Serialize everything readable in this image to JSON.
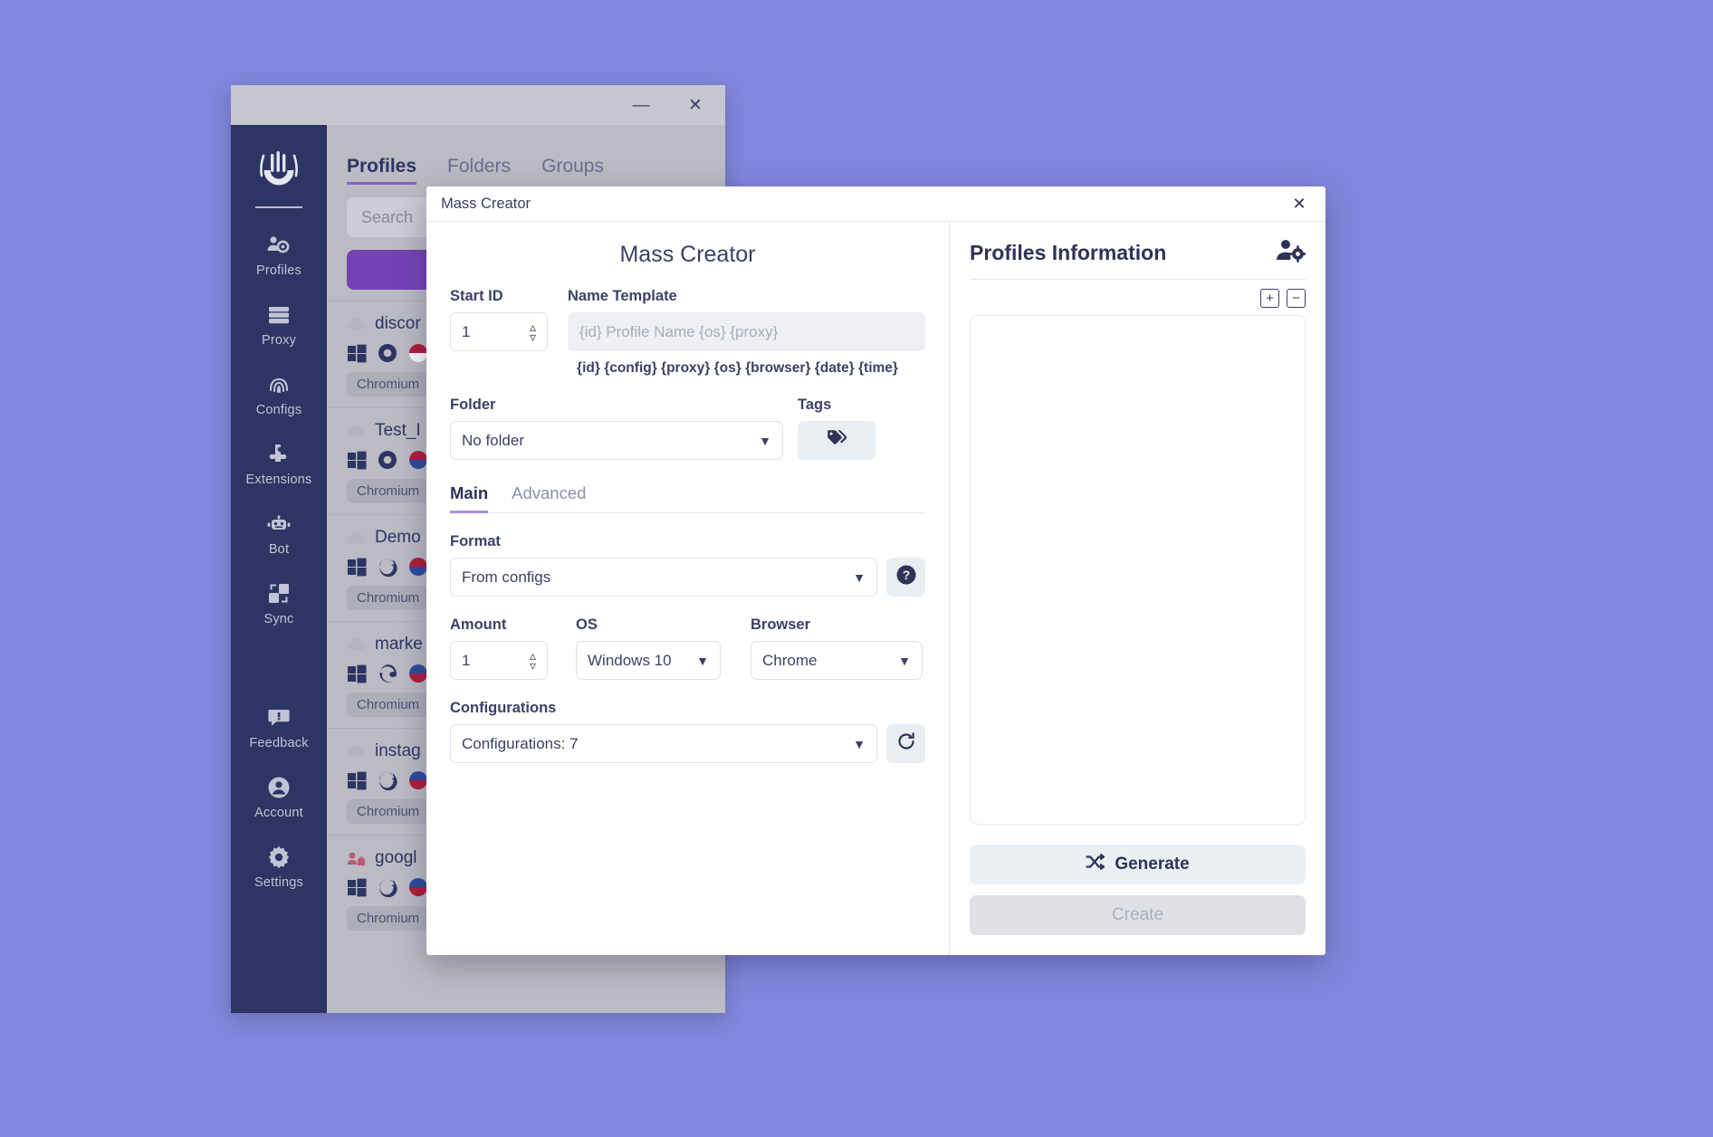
{
  "background_window": {
    "titlebar": {
      "minimize_label": "—",
      "close_label": "✕"
    },
    "sidebar": {
      "logo_name": "undetectable-logo",
      "items": [
        {
          "label": "Profiles",
          "icon": "profiles-icon"
        },
        {
          "label": "Proxy",
          "icon": "proxy-icon"
        },
        {
          "label": "Configs",
          "icon": "configs-icon"
        },
        {
          "label": "Extensions",
          "icon": "extensions-icon"
        },
        {
          "label": "Bot",
          "icon": "bot-icon"
        },
        {
          "label": "Sync",
          "icon": "sync-icon"
        },
        {
          "label": "Feedback",
          "icon": "feedback-icon"
        },
        {
          "label": "Account",
          "icon": "account-icon"
        },
        {
          "label": "Settings",
          "icon": "settings-icon"
        }
      ]
    },
    "tabs": [
      {
        "label": "Profiles",
        "active": true
      },
      {
        "label": "Folders",
        "active": false
      },
      {
        "label": "Groups",
        "active": false
      }
    ],
    "search_placeholder": "Search",
    "profile_rows": [
      {
        "name": "discor",
        "badge": "Chromium",
        "browser_icon": "chrome-icon",
        "shared": false
      },
      {
        "name": "Test_I",
        "badge": "Chromium",
        "browser_icon": "chrome-icon",
        "shared": false
      },
      {
        "name": "Demo",
        "badge": "Chromium",
        "browser_icon": "firefox-icon",
        "shared": false
      },
      {
        "name": "marke",
        "badge": "Chromium",
        "browser_icon": "edge-icon",
        "shared": false
      },
      {
        "name": "instag",
        "badge": "Chromium",
        "browser_icon": "firefox-icon",
        "shared": false
      },
      {
        "name": "googl",
        "badge": "Chromium",
        "browser_icon": "firefox-icon",
        "shared": true
      }
    ]
  },
  "dialog": {
    "window_title": "Mass Creator",
    "close_label": "✕",
    "form_title": "Mass Creator",
    "start_id": {
      "label": "Start ID",
      "value": "1"
    },
    "name_template": {
      "label": "Name Template",
      "value": "",
      "placeholder": "{id} Profile Name {os} {proxy}"
    },
    "token_hint": "{id} {config} {proxy} {os} {browser} {date} {time}",
    "folder": {
      "label": "Folder",
      "value": "No folder",
      "options": [
        "No folder"
      ]
    },
    "tags": {
      "label": "Tags",
      "icon": "tag-icon"
    },
    "sub_tabs": [
      {
        "label": "Main",
        "active": true
      },
      {
        "label": "Advanced",
        "active": false
      }
    ],
    "format": {
      "label": "Format",
      "value": "From configs",
      "options": [
        "From configs"
      ],
      "help_icon": "help-icon"
    },
    "amount": {
      "label": "Amount",
      "value": "1"
    },
    "os": {
      "label": "OS",
      "value": "Windows 10",
      "options": [
        "Windows 10"
      ]
    },
    "browser": {
      "label": "Browser",
      "value": "Chrome",
      "options": [
        "Chrome"
      ]
    },
    "configurations": {
      "label": "Configurations",
      "value": "Configurations: 7",
      "options": [
        "Configurations: 7"
      ],
      "refresh_icon": "refresh-icon"
    },
    "right_panel": {
      "title": "Profiles Information",
      "header_icon": "user-settings-icon",
      "expand_label": "+",
      "collapse_label": "−",
      "list_items": []
    },
    "generate_button": {
      "label": "Generate",
      "icon": "shuffle-icon"
    },
    "create_button": {
      "label": "Create",
      "disabled": true
    }
  },
  "colors": {
    "desktop_background": "#8187dd",
    "sidebar": "#2a3360",
    "accent_purple": "#7540b5",
    "tab_underline": "#8b5fc9",
    "subtab_underline": "#a98ede",
    "text_dark": "#2e3357",
    "button_light": "#eaf0f4",
    "button_disabled": "#dfe1e6"
  }
}
